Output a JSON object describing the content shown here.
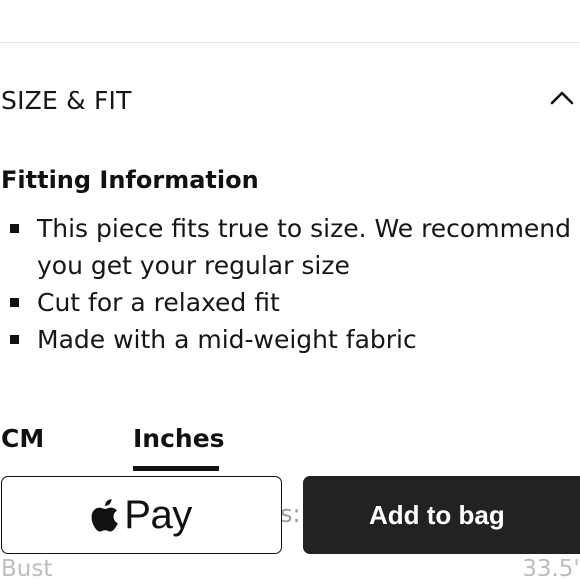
{
  "size_fit": {
    "title": "SIZE & FIT",
    "toggle_icon": "chevron-up-icon"
  },
  "fitting": {
    "heading": "Fitting Information",
    "items": [
      {
        "line1": "This piece fits true to size. We recommend",
        "line2": "you get your regular size"
      },
      {
        "line1": "Cut for a relaxed fit"
      },
      {
        "line1": "Made with a mid-weight fabric"
      }
    ]
  },
  "units": {
    "tabs": [
      {
        "label": "CM",
        "selected": false
      },
      {
        "label": "Inches",
        "selected": true
      }
    ]
  },
  "checkout": {
    "apple_pay_label": "Pay",
    "apple_pay_icon": "apple-icon",
    "hidden_text_fragment": "s:",
    "add_to_bag_label": "Add to bag"
  },
  "measurements": {
    "label": "Bust",
    "value": "33.5\""
  },
  "colors": {
    "button_dark": "#222222",
    "text": "#111111",
    "divider": "#e8e8e8",
    "muted": "#bdbdbd"
  }
}
